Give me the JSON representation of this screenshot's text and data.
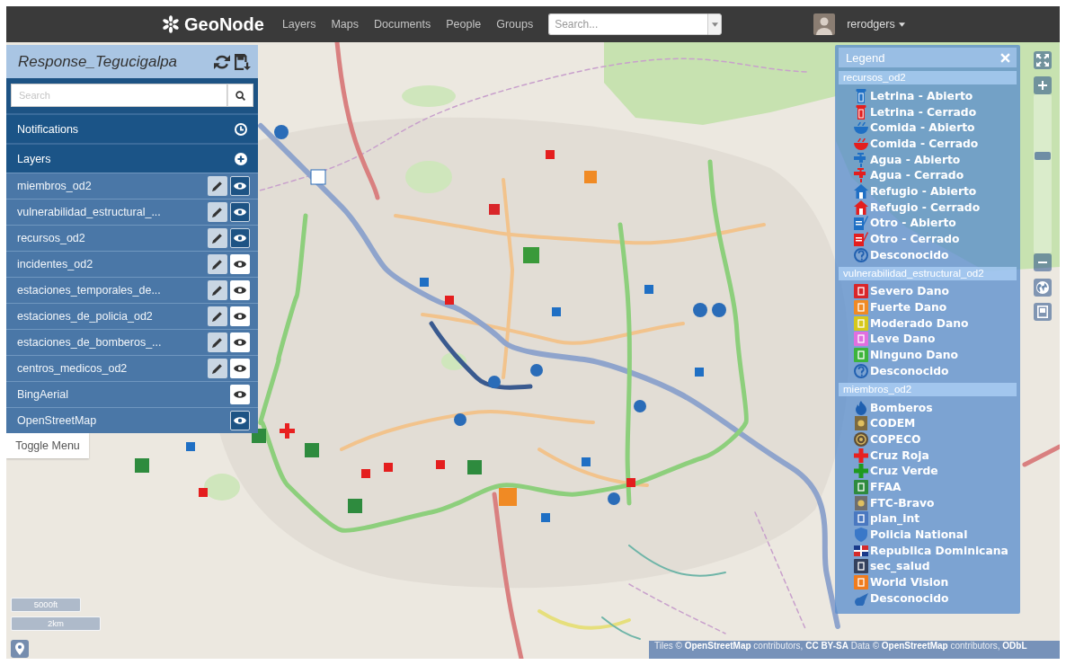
{
  "navbar": {
    "brand": "GeoNode",
    "links": [
      "Layers",
      "Maps",
      "Documents",
      "People",
      "Groups"
    ],
    "search": {
      "placeholder": "Search..."
    },
    "user": {
      "name": "rerodgers"
    }
  },
  "sidebar": {
    "title": "Response_Tegucigalpa",
    "search": {
      "placeholder": "Search"
    },
    "sections": [
      {
        "label": "Notifications",
        "kind": "notifications"
      },
      {
        "label": "Layers",
        "kind": "layers"
      }
    ],
    "layers": [
      {
        "name": "miembros_od2",
        "editable": true,
        "visible": true
      },
      {
        "name": "vulnerabilidad_estructural_...",
        "editable": true,
        "visible": true
      },
      {
        "name": "recursos_od2",
        "editable": true,
        "visible": true
      },
      {
        "name": "incidentes_od2",
        "editable": true,
        "visible": false
      },
      {
        "name": "estaciones_temporales_de...",
        "editable": true,
        "visible": false
      },
      {
        "name": "estaciones_de_policia_od2",
        "editable": true,
        "visible": false
      },
      {
        "name": "estaciones_de_bomberos_...",
        "editable": true,
        "visible": false
      },
      {
        "name": "centros_medicos_od2",
        "editable": true,
        "visible": false
      },
      {
        "name": "BingAerial",
        "editable": false,
        "visible": false
      },
      {
        "name": "OpenStreetMap",
        "editable": false,
        "visible": true
      }
    ],
    "toggle_button": "Toggle Menu"
  },
  "legend": {
    "title": "Legend",
    "groups": [
      {
        "title": "recursos_od2",
        "items": [
          {
            "label": "Letrina - Abierto",
            "kind": "latrine",
            "color": "#1f6fc4"
          },
          {
            "label": "Letrina - Cerrado",
            "kind": "latrine",
            "color": "#e41e1e"
          },
          {
            "label": "Comida - Abierto",
            "kind": "food",
            "color": "#1f6fc4"
          },
          {
            "label": "Comida - Cerrado",
            "kind": "food",
            "color": "#e41e1e"
          },
          {
            "label": "Agua - Abierto",
            "kind": "tap",
            "color": "#1f6fc4"
          },
          {
            "label": "Agua - Cerrado",
            "kind": "tap",
            "color": "#e41e1e"
          },
          {
            "label": "Refugio - Abierto",
            "kind": "house",
            "color": "#1f6fc4"
          },
          {
            "label": "Refugio - Cerrado",
            "kind": "house",
            "color": "#e41e1e"
          },
          {
            "label": "Otro - Abierto",
            "kind": "note",
            "color": "#1f6fc4"
          },
          {
            "label": "Otro - Cerrado",
            "kind": "note",
            "color": "#e41e1e"
          },
          {
            "label": "Desconocido",
            "kind": "question",
            "color": "#2160b0"
          }
        ]
      },
      {
        "title": "vulnerabilidad_estructural_od2",
        "items": [
          {
            "label": "Severo Dano",
            "kind": "tile",
            "color": "#d9262a"
          },
          {
            "label": "Fuerte Dano",
            "kind": "tile",
            "color": "#f08a24"
          },
          {
            "label": "Moderado Dano",
            "kind": "tile",
            "color": "#d6c81c"
          },
          {
            "label": "Leve Dano",
            "kind": "tile",
            "color": "#e06fe0"
          },
          {
            "label": "Ninguno Dano",
            "kind": "tile",
            "color": "#3cb43c"
          },
          {
            "label": "Desconocido",
            "kind": "question",
            "color": "#2160b0"
          }
        ]
      },
      {
        "title": "miembros_od2",
        "items": [
          {
            "label": "Bomberos",
            "kind": "flame",
            "color": "#1e5fb0"
          },
          {
            "label": "CODEM",
            "kind": "emblem",
            "color": "#7d6a3f"
          },
          {
            "label": "COPECO",
            "kind": "seal",
            "color": "#5e4e36"
          },
          {
            "label": "Cruz Roja",
            "kind": "cross",
            "color": "#e82020"
          },
          {
            "label": "Cruz Verde",
            "kind": "cross",
            "color": "#1e9a1e"
          },
          {
            "label": "FFAA",
            "kind": "tile",
            "color": "#2e8b3e"
          },
          {
            "label": "FTC-Bravo",
            "kind": "emblem",
            "color": "#6e6e6e"
          },
          {
            "label": "plan_int",
            "kind": "tile",
            "color": "#4a78c0"
          },
          {
            "label": "Policia National",
            "kind": "shield",
            "color": "#3a78c8"
          },
          {
            "label": "Republica Dominicana",
            "kind": "flag",
            "color": "#1a3a8a"
          },
          {
            "label": "sec_salud",
            "kind": "tile",
            "color": "#33415e"
          },
          {
            "label": "World Vision",
            "kind": "tile",
            "color": "#f07c1e"
          },
          {
            "label": "Desconocido",
            "kind": "drop",
            "color": "#2a6ab8"
          }
        ]
      }
    ]
  },
  "map": {
    "zoom": {
      "level": 0.62
    },
    "scale": [
      "5000ft",
      "2km"
    ],
    "attribution": [
      {
        "text": "Tiles ©",
        "kind": "text"
      },
      {
        "text": "OpenStreetMap",
        "kind": "link"
      },
      {
        "text": "contributors,",
        "kind": "text"
      },
      {
        "text": "CC BY-SA",
        "kind": "link"
      },
      {
        "text": "Data ©",
        "kind": "text"
      },
      {
        "text": "OpenStreetMap",
        "kind": "link"
      },
      {
        "text": "contributors,",
        "kind": "text"
      },
      {
        "text": "ODbL",
        "kind": "link"
      }
    ]
  }
}
